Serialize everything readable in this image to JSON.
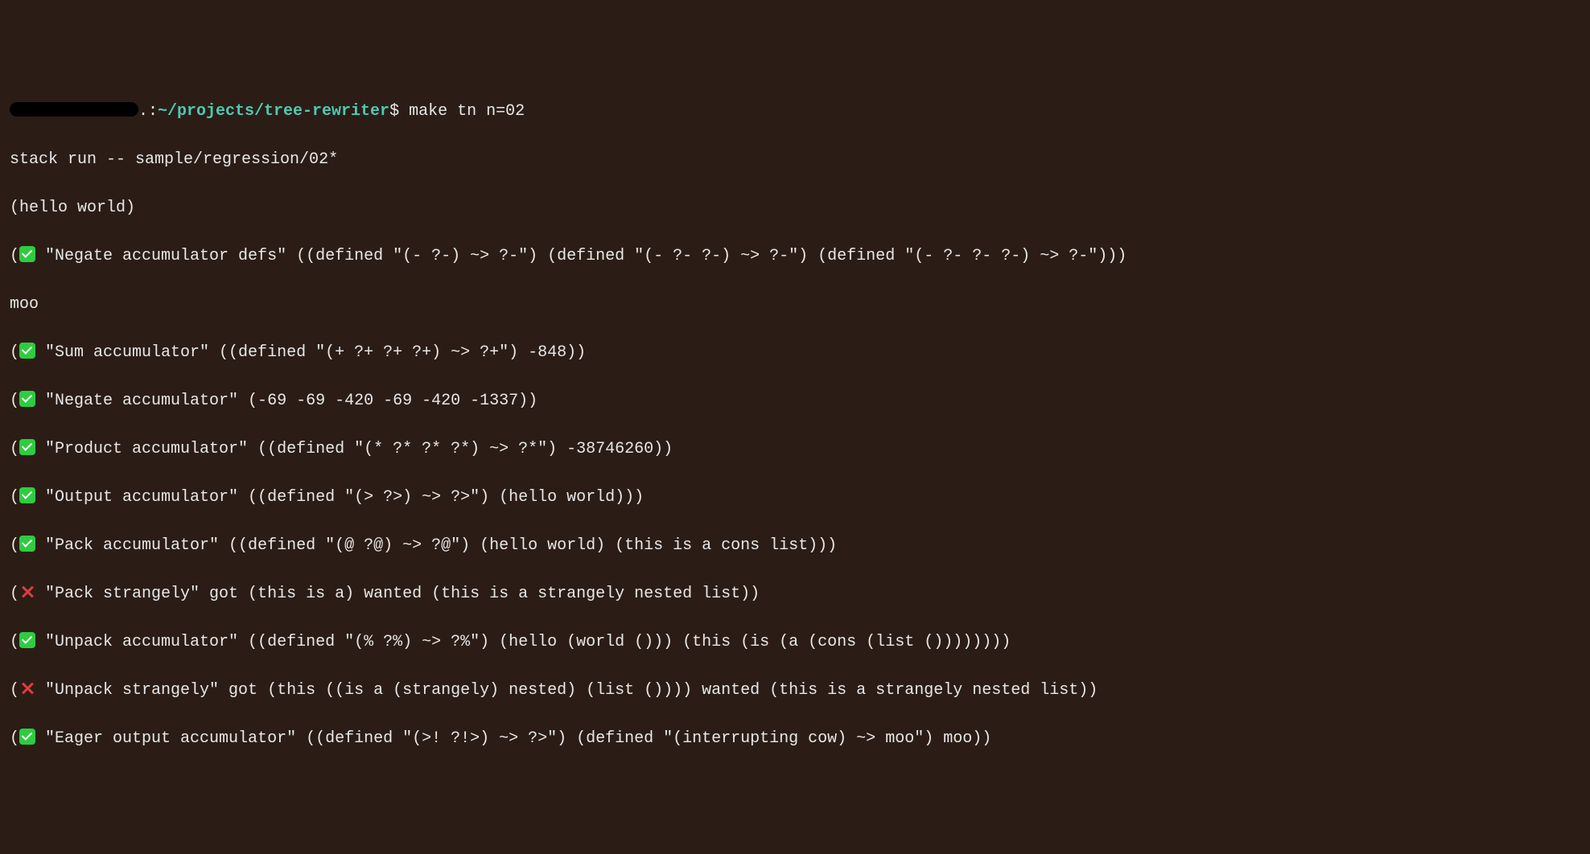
{
  "prompt": {
    "host_suffix": ".:",
    "path": "~/projects/tree-rewriter",
    "dollar": "$",
    "command": "make tn n=02"
  },
  "plain_lines": {
    "stack_run": "stack run -- sample/regression/02*",
    "hello_world": "(hello world)",
    "moo": "moo"
  },
  "results": {
    "negate_defs": {
      "before": "(",
      "after": " \"Negate accumulator defs\" ((defined \"(- ?-) ~> ?-\") (defined \"(- ?- ?-) ~> ?-\") (defined \"(- ?- ?- ?-) ~> ?-\")))"
    },
    "sum": {
      "before": "(",
      "after": " \"Sum accumulator\" ((defined \"(+ ?+ ?+ ?+) ~> ?+\") -848))"
    },
    "negate": {
      "before": "(",
      "after": " \"Negate accumulator\" (-69 -69 -420 -69 -420 -1337))"
    },
    "product": {
      "before": "(",
      "after": " \"Product accumulator\" ((defined \"(* ?* ?* ?*) ~> ?*\") -38746260))"
    },
    "output": {
      "before": "(",
      "after": " \"Output accumulator\" ((defined \"(> ?>) ~> ?>\") (hello world)))"
    },
    "pack": {
      "before": "(",
      "after": " \"Pack accumulator\" ((defined \"(@ ?@) ~> ?@\") (hello world) (this is a cons list)))"
    },
    "pack_strangely": {
      "before": "(",
      "after": " \"Pack strangely\" got (this is a) wanted (this is a strangely nested list))"
    },
    "unpack": {
      "before": "(",
      "after": " \"Unpack accumulator\" ((defined \"(% ?%) ~> ?%\") (hello (world ())) (this (is (a (cons (list ())))))))"
    },
    "unpack_strangely": {
      "before": "(",
      "after": " \"Unpack strangely\" got (this ((is a (strangely) nested) (list ()))) wanted (this is a strangely nested list))"
    },
    "eager": {
      "before": "(",
      "after": " \"Eager output accumulator\" ((defined \"(>! ?!>) ~> ?>\") (defined \"(interrupting cow) ~> moo\") moo))"
    }
  }
}
